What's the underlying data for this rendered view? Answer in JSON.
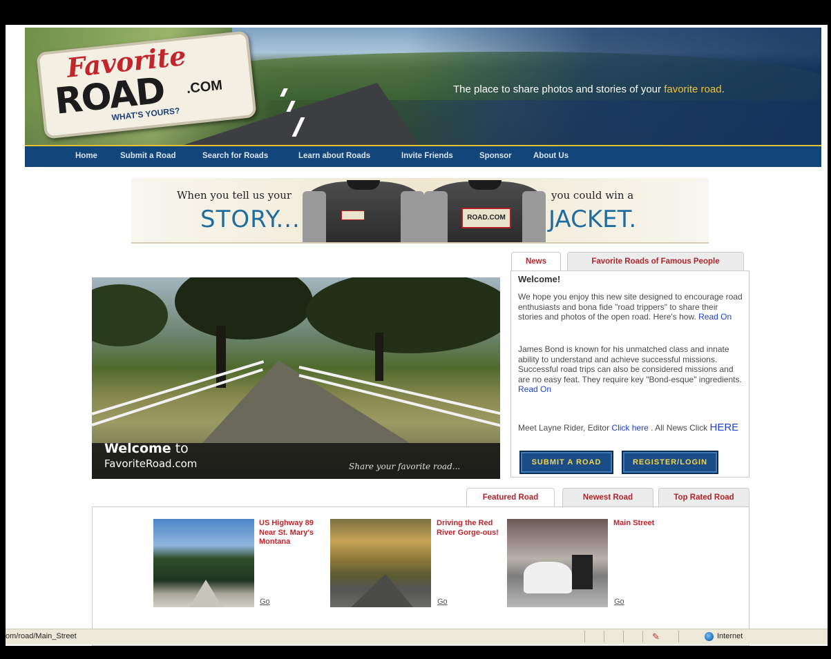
{
  "header": {
    "logo_favorite": "Favorite",
    "logo_road": "ROAD",
    "logo_com": ".COM",
    "logo_tagline": "WHAT'S YOURS?",
    "tagline_prefix": "The place to share photos and stories of your ",
    "tagline_highlight": "favorite road",
    "tagline_suffix": "."
  },
  "nav": {
    "items": [
      "Home",
      "Submit a Road",
      "Search for Roads",
      "Learn about Roads",
      "Invite Friends",
      "Sponsor",
      "About Us"
    ]
  },
  "banner": {
    "left_small": "When you tell us your",
    "left_big": "STORY...",
    "right_small": "you could win a",
    "right_big": "JACKET.",
    "patch_text": "ROAD.COM"
  },
  "hero": {
    "welcome_bold": "Welcome",
    "welcome_rest": " to",
    "site": "FavoriteRoad.com",
    "share": "Share your favorite road..."
  },
  "news": {
    "tabs": [
      "News",
      "Favorite Roads of Famous People"
    ],
    "title": "Welcome!",
    "p1": "We hope you enjoy this new site designed to encourage road enthusiasts and bona fide \"road trippers\" to share their stories and photos of the open road. Here's how.",
    "p1_link": "Read On",
    "p2": "James Bond is known for his unmatched class and innate ability to understand and achieve successful missions. Successful road trips can also be considered missions and are no easy feat. They require key \"Bond-esque\" ingredients.",
    "p2_link": "Read On",
    "p3_prefix": "Meet Layne Rider, Editor",
    "p3_link": "Click here",
    "p3_mid": ". All News Click",
    "p3_link2": "HERE",
    "btn_submit": "SUBMIT A ROAD",
    "btn_register": "REGISTER/LOGIN"
  },
  "featured": {
    "tabs": [
      "Featured Road",
      "Newest Road",
      "Top Rated Road"
    ],
    "roads": [
      {
        "title": "US Highway 89 Near St. Mary's Montana",
        "go": "Go"
      },
      {
        "title": "Driving the Red River Gorge-ous!",
        "go": "Go"
      },
      {
        "title": "Main Street",
        "go": "Go"
      }
    ]
  },
  "statusbar": {
    "url": "om/road/Main_Street",
    "zone": "Internet"
  }
}
